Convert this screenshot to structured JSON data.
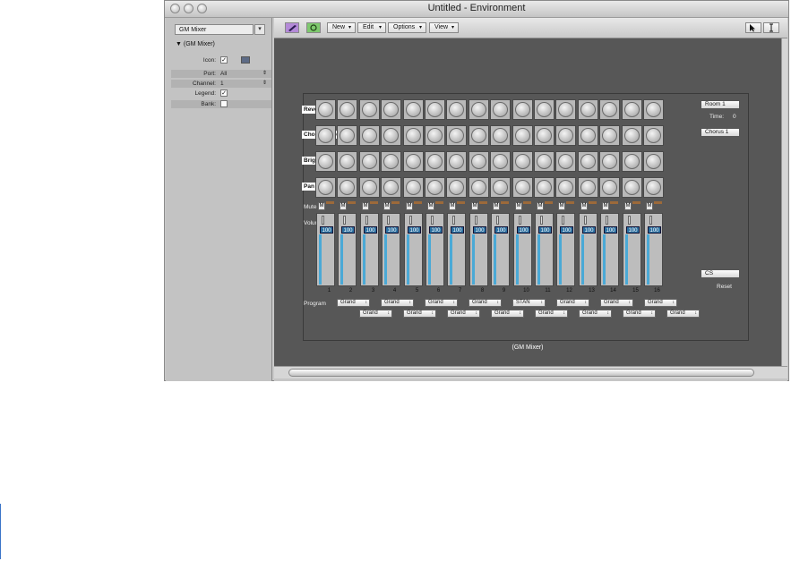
{
  "window": {
    "title": "Untitled - Environment"
  },
  "inspector": {
    "object": "GM Mixer",
    "header": "▼ (GM Mixer)",
    "params": {
      "icon": "Icon:",
      "port": "Port:",
      "port_value": "All",
      "channel": "Channel:",
      "channel_value": "1",
      "legend": "Legend:",
      "bank": "Bank:"
    }
  },
  "toolbar": {
    "new": "New",
    "edit": "Edit",
    "options": "Options",
    "view": "View"
  },
  "mixer": {
    "name": "(GM Mixer)",
    "rows": {
      "reverb": "Reverb",
      "chorus": "Chorus Dept",
      "brightness": "Brightness",
      "pan": "Pan",
      "mute": "Mute",
      "volume": "Volume",
      "program": "Program"
    },
    "volume_values": [
      "100",
      "100",
      "100",
      "100",
      "100",
      "100",
      "100",
      "100",
      "100",
      "100",
      "100",
      "100",
      "100",
      "100",
      "100",
      "100"
    ],
    "channels": [
      "1",
      "2",
      "3",
      "4",
      "5",
      "6",
      "7",
      "8",
      "9",
      "10",
      "11",
      "12",
      "13",
      "14",
      "15",
      "16"
    ],
    "programs": [
      "Grand",
      "Grand",
      "Grand",
      "Grand",
      "Grand",
      "Grand",
      "Grand",
      "Grand",
      "STAN",
      "Grand",
      "Grand",
      "Grand",
      "Grand",
      "Grand",
      "Grand",
      "Grand"
    ],
    "mute_label": "M",
    "side": {
      "room": "Room 1",
      "time": "Time:",
      "time_value": "0",
      "chorus": "Chorus 1",
      "cs": "CS",
      "reset": "Reset"
    }
  },
  "icons": [
    "close-icon",
    "minimize-icon",
    "zoom-icon",
    "pencil-icon",
    "link-icon",
    "pointer-tool-icon",
    "text-tool-icon"
  ]
}
